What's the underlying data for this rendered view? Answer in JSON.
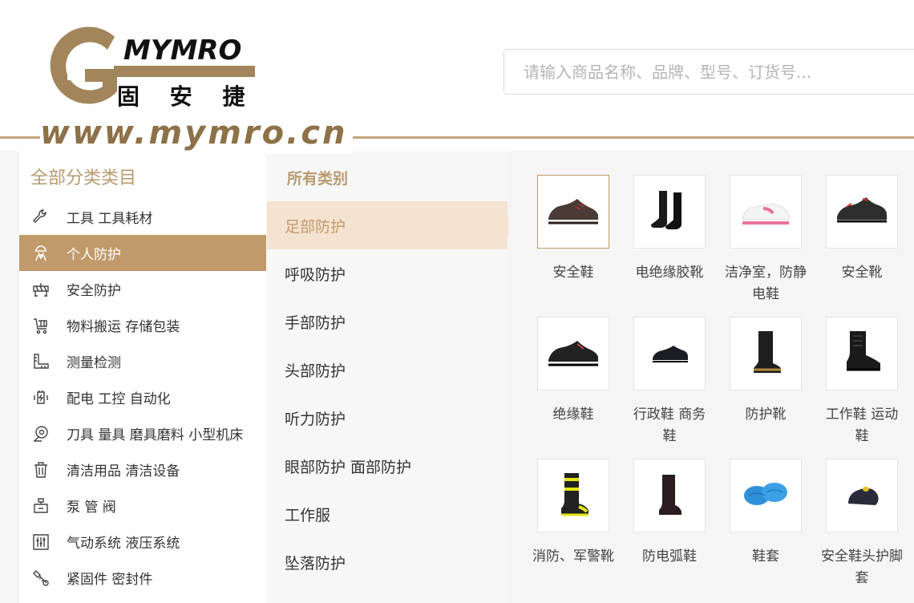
{
  "header": {
    "logo_brand": "MYMRO",
    "logo_cn": "固 安 捷",
    "logo_url": "www.mymro.cn",
    "search_placeholder": "请输入商品名称、品牌、型号、订货号..."
  },
  "sidebar": {
    "title": "全部分类类目",
    "items": [
      {
        "label": "工具 工具耗材",
        "icon": "wrench-icon"
      },
      {
        "label": "个人防护",
        "icon": "worker-icon"
      },
      {
        "label": "安全防护",
        "icon": "barrier-icon"
      },
      {
        "label": "物料搬运 存储包装",
        "icon": "cart-icon"
      },
      {
        "label": "测量检测",
        "icon": "ruler-icon"
      },
      {
        "label": "配电 工控 自动化",
        "icon": "plug-icon"
      },
      {
        "label": "刀具 量具 磨具磨料 小型机床",
        "icon": "blade-icon"
      },
      {
        "label": "清洁用品 清洁设备",
        "icon": "trash-icon"
      },
      {
        "label": "泵 管 阀",
        "icon": "pump-icon"
      },
      {
        "label": "气动系统 液压系统",
        "icon": "hydraulic-icon"
      },
      {
        "label": "紧固件 密封件",
        "icon": "bolt-icon"
      }
    ],
    "active_index": 1
  },
  "subcategories": {
    "title": "所有类别",
    "items": [
      "足部防护",
      "呼吸防护",
      "手部防护",
      "头部防护",
      "听力防护",
      "眼部防护 面部防护",
      "工作服",
      "坠落防护"
    ],
    "active_index": 0
  },
  "products": [
    {
      "name": "安全鞋",
      "icon": "low-safety-shoe-icon"
    },
    {
      "name": "电绝缘胶靴",
      "icon": "rubber-boot-icon"
    },
    {
      "name": "洁净室，防静电鞋",
      "icon": "cleanroom-shoe-icon"
    },
    {
      "name": "安全靴",
      "icon": "sport-safety-shoe-icon"
    },
    {
      "name": "绝缘鞋",
      "icon": "insulated-shoe-icon"
    },
    {
      "name": "行政鞋 商务鞋",
      "icon": "business-shoe-icon"
    },
    {
      "name": "防护靴",
      "icon": "tall-boot-icon"
    },
    {
      "name": "工作鞋 运动鞋",
      "icon": "work-boot-icon"
    },
    {
      "name": "消防、军警靴",
      "icon": "fire-boot-icon"
    },
    {
      "name": "防电弧鞋",
      "icon": "arc-boot-icon"
    },
    {
      "name": "鞋套",
      "icon": "shoe-cover-icon"
    },
    {
      "name": "安全鞋头护脚套",
      "icon": "toe-cap-icon"
    }
  ],
  "colors": {
    "brand": "#8d7147",
    "accent": "#c19a6b",
    "active_sub_bg": "#f5e3d1",
    "title_color": "#b89a6f"
  }
}
